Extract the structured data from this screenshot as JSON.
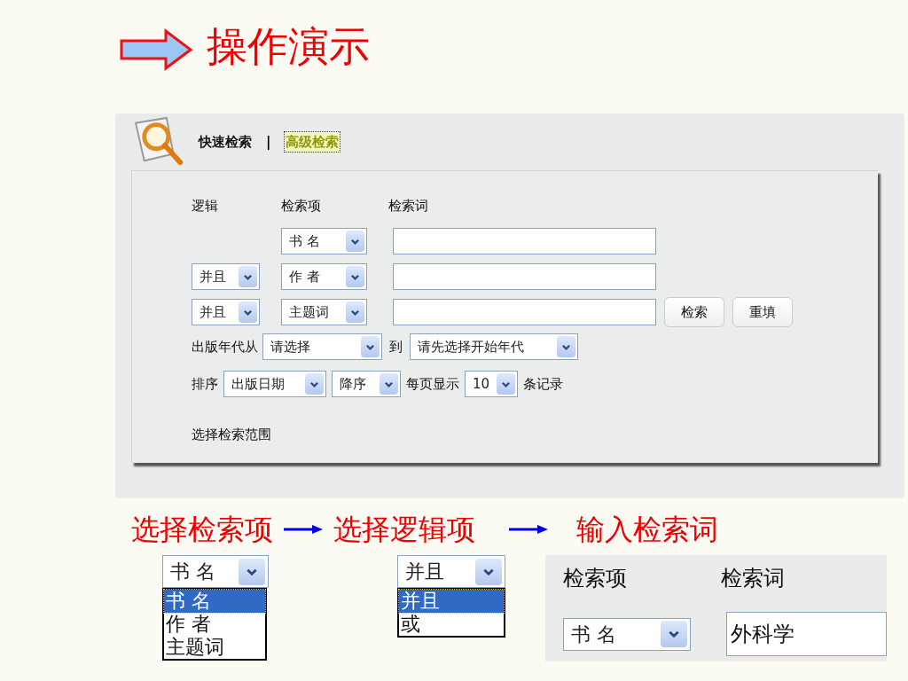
{
  "title": "操作演示",
  "search_panel": {
    "tabs": [
      {
        "label": "快速检索",
        "selected": false
      },
      {
        "label": "高级检索",
        "selected": true
      }
    ],
    "separator": "|",
    "headers": [
      "逻辑",
      "检索项",
      "检索词"
    ],
    "rows": [
      {
        "field": "书 名"
      },
      {
        "logic": "并且",
        "field": "作 者"
      },
      {
        "logic": "并且",
        "field": "主题词"
      }
    ],
    "buttons": [
      "检索",
      "重填"
    ],
    "year": {
      "label": "出版年代从",
      "from": "请选择",
      "to_label": "到",
      "to": "请先选择开始年代"
    },
    "sort": {
      "label": "排序",
      "field": "出版日期",
      "order": "降序",
      "per_page_label": "每页显示",
      "per_page": "10",
      "records_label": "条记录"
    },
    "scope_label": "选择检索范围"
  },
  "steps": [
    "选择检索项",
    "选择逻辑项",
    "输入检索词"
  ],
  "field_demo": {
    "value": "书 名",
    "options": [
      {
        "label": "书 名",
        "selected": true
      },
      {
        "label": "作 者",
        "selected": false
      },
      {
        "label": "主题词",
        "selected": false
      }
    ]
  },
  "logic_demo": {
    "value": "并且",
    "options": [
      {
        "label": "并且",
        "selected": true
      },
      {
        "label": "或",
        "selected": false
      }
    ]
  },
  "input_demo": {
    "headers": [
      "检索项",
      "检索词"
    ],
    "field": "书 名",
    "term": "外科学"
  }
}
